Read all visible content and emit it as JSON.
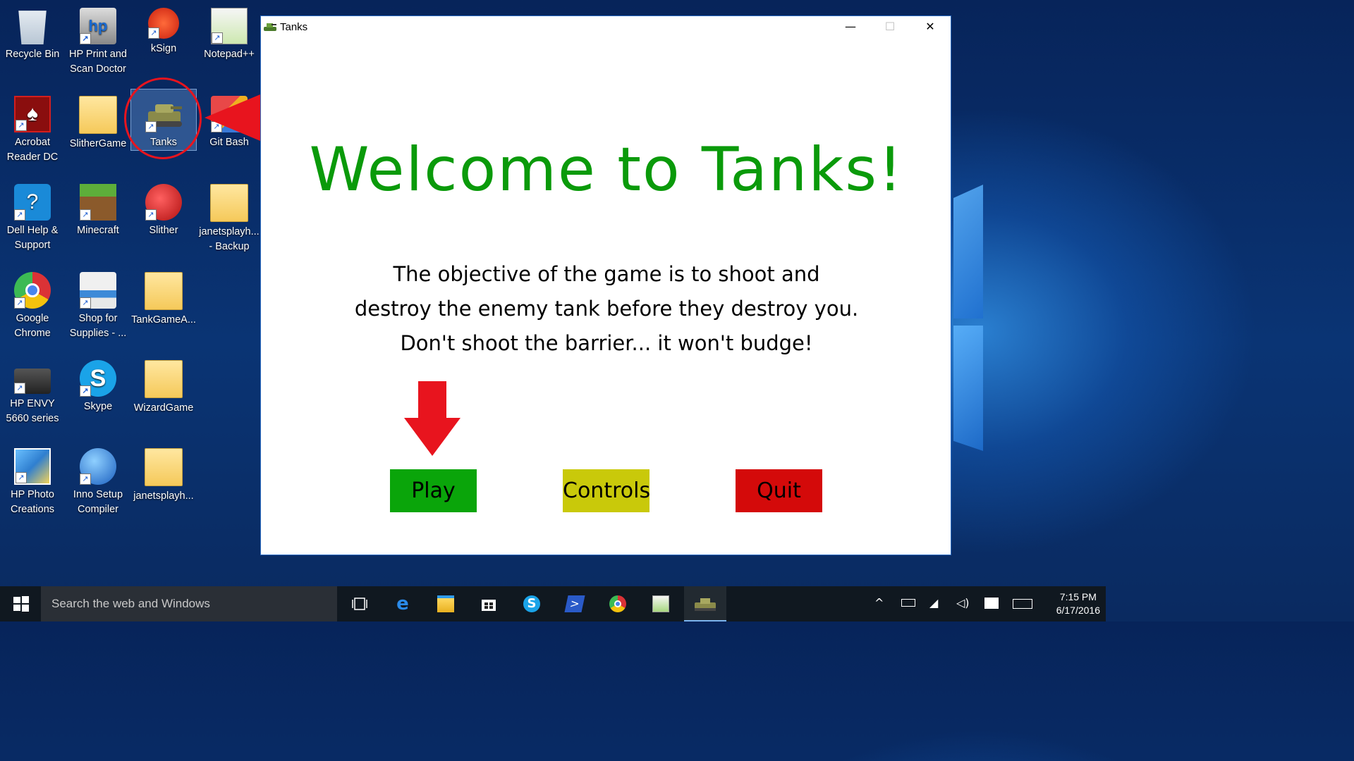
{
  "desktop": {
    "icons": [
      {
        "label": "Recycle Bin"
      },
      {
        "label": "HP Print and Scan Doctor"
      },
      {
        "label": "kSign"
      },
      {
        "label": "Notepad++"
      },
      {
        "label": "Acrobat Reader DC"
      },
      {
        "label": "SlitherGame"
      },
      {
        "label": "Tanks"
      },
      {
        "label": "Git Bash"
      },
      {
        "label": "Dell Help & Support"
      },
      {
        "label": "Minecraft"
      },
      {
        "label": "Slither"
      },
      {
        "label": "janetsplayh... - Backup"
      },
      {
        "label": "Google Chrome"
      },
      {
        "label": "Shop for Supplies - ..."
      },
      {
        "label": "TankGameA..."
      },
      {
        "label": "HP ENVY 5660 series"
      },
      {
        "label": "Skype"
      },
      {
        "label": "WizardGame"
      },
      {
        "label": "HP Photo Creations"
      },
      {
        "label": "Inno Setup Compiler"
      },
      {
        "label": "janetsplayh..."
      }
    ]
  },
  "window": {
    "title": "Tanks",
    "minimize_glyph": "—",
    "maximize_glyph": "☐",
    "close_glyph": "✕",
    "heading": "Welcome to Tanks!",
    "objective_lines": [
      "The objective of the game is to shoot and",
      "destroy the enemy tank before they destroy you.",
      "Don't shoot the barrier... it won't budge!"
    ],
    "buttons": {
      "play": "Play",
      "controls": "Controls",
      "quit": "Quit"
    }
  },
  "taskbar": {
    "search_placeholder": "Search the web and Windows",
    "time": "7:15 PM",
    "date": "6/17/2016"
  },
  "colors": {
    "heading_green": "#0a9a0a",
    "play_green": "#0aa50a",
    "controls_yellow": "#c9c90a",
    "quit_red": "#d40a0a",
    "annotation_red": "#e8141e"
  }
}
